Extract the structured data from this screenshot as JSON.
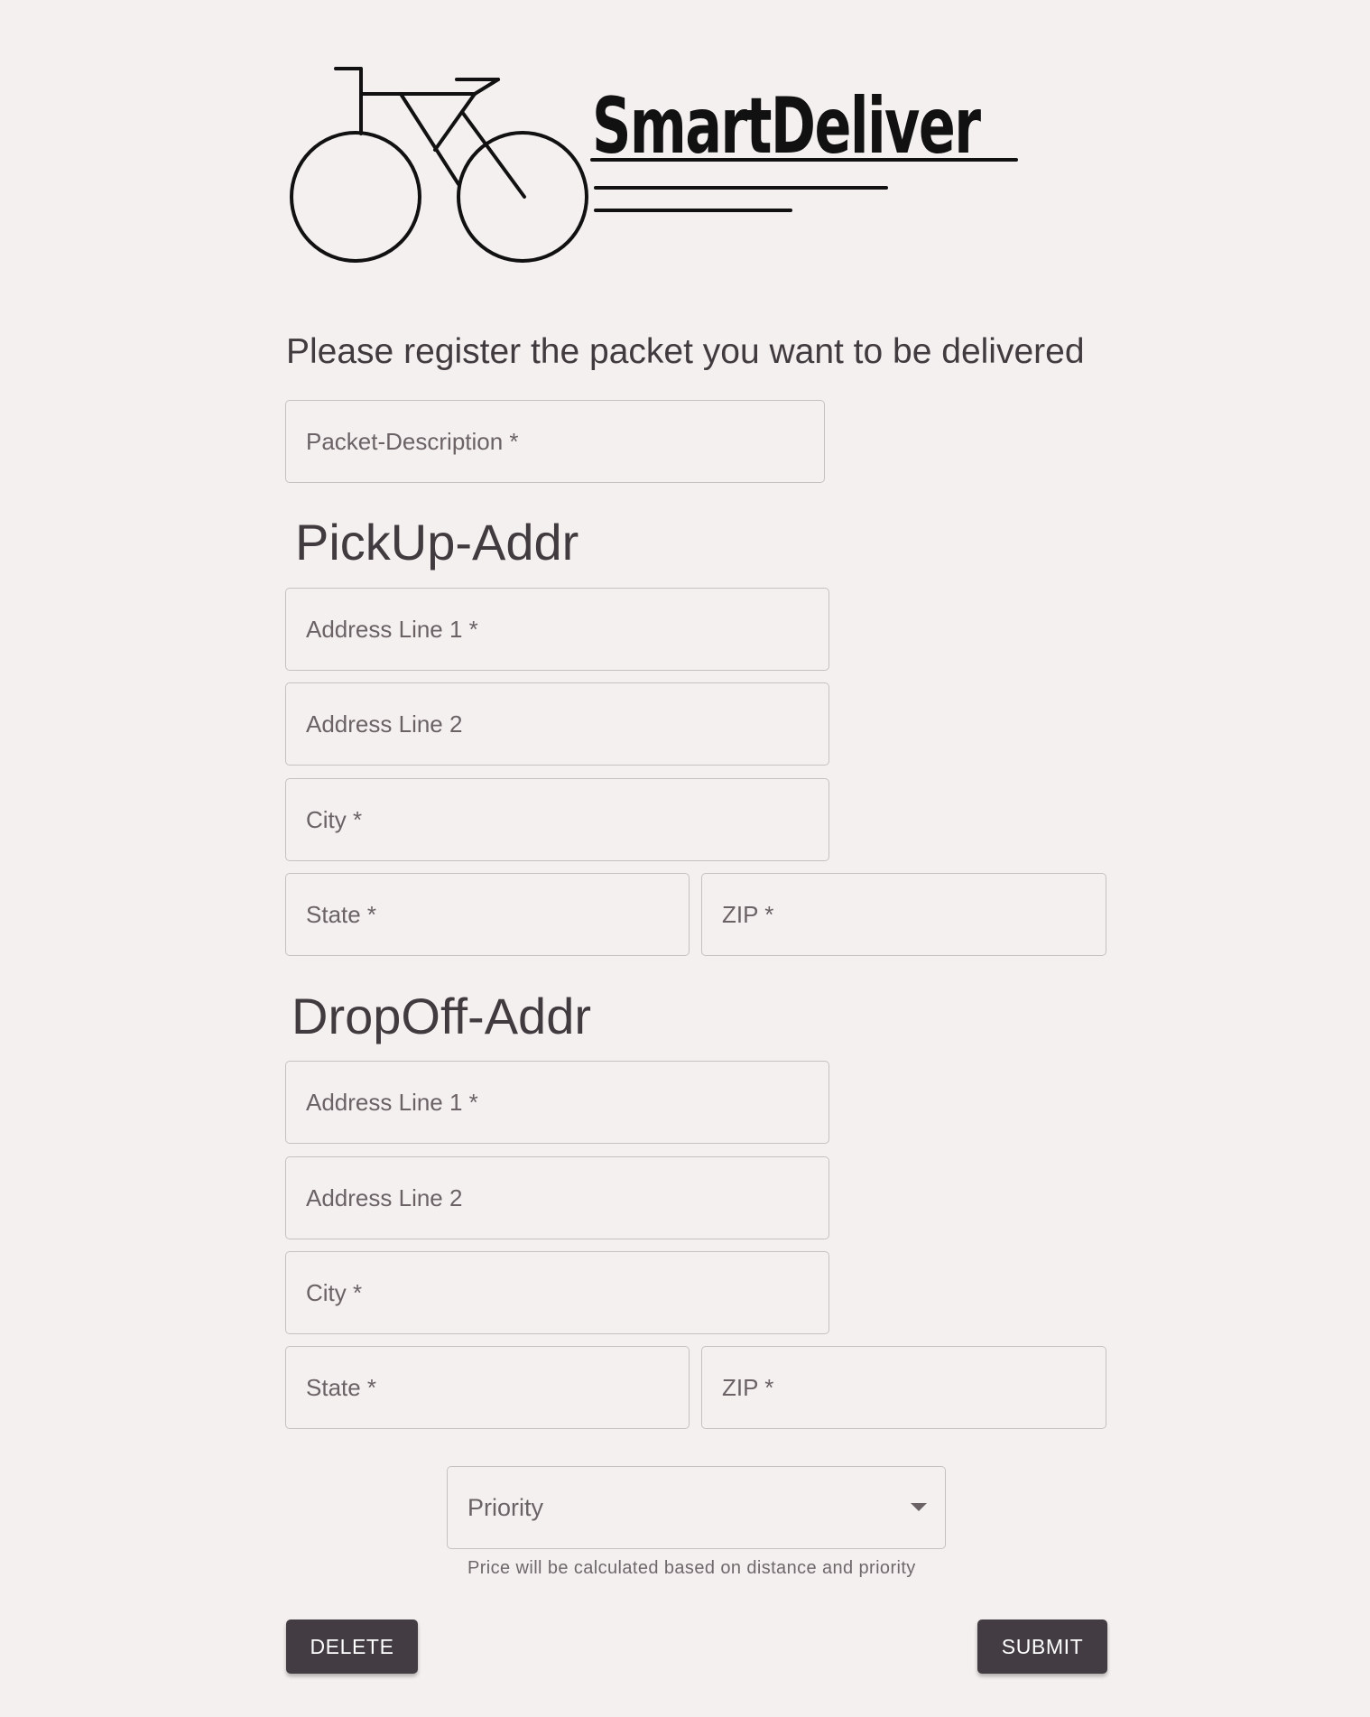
{
  "logo": {
    "text": "SmartDeliver",
    "icon": "bicycle-icon"
  },
  "form": {
    "title": "Please register the packet you want to be delivered",
    "packet_description_label": "Packet-Description *"
  },
  "pickup": {
    "heading": "PickUp-Addr",
    "address_line1_label": "Address Line 1 *",
    "address_line2_label": "Address Line 2",
    "city_label": "City *",
    "state_label": "State *",
    "zip_label": "ZIP *"
  },
  "dropoff": {
    "heading": "DropOff-Addr",
    "address_line1_label": "Address Line 1 *",
    "address_line2_label": "Address Line 2",
    "city_label": "City *",
    "state_label": "State *",
    "zip_label": "ZIP *"
  },
  "priority": {
    "label": "Priority",
    "icon": "chevron-down-icon",
    "helper_text": "Price will be calculated based on distance and priority"
  },
  "actions": {
    "delete_label": "DELETE",
    "submit_label": "SUBMIT"
  },
  "colors": {
    "background": "#f5f0f0",
    "text": "#413b3f",
    "button": "#433c43",
    "border": "#c7c0c2"
  }
}
